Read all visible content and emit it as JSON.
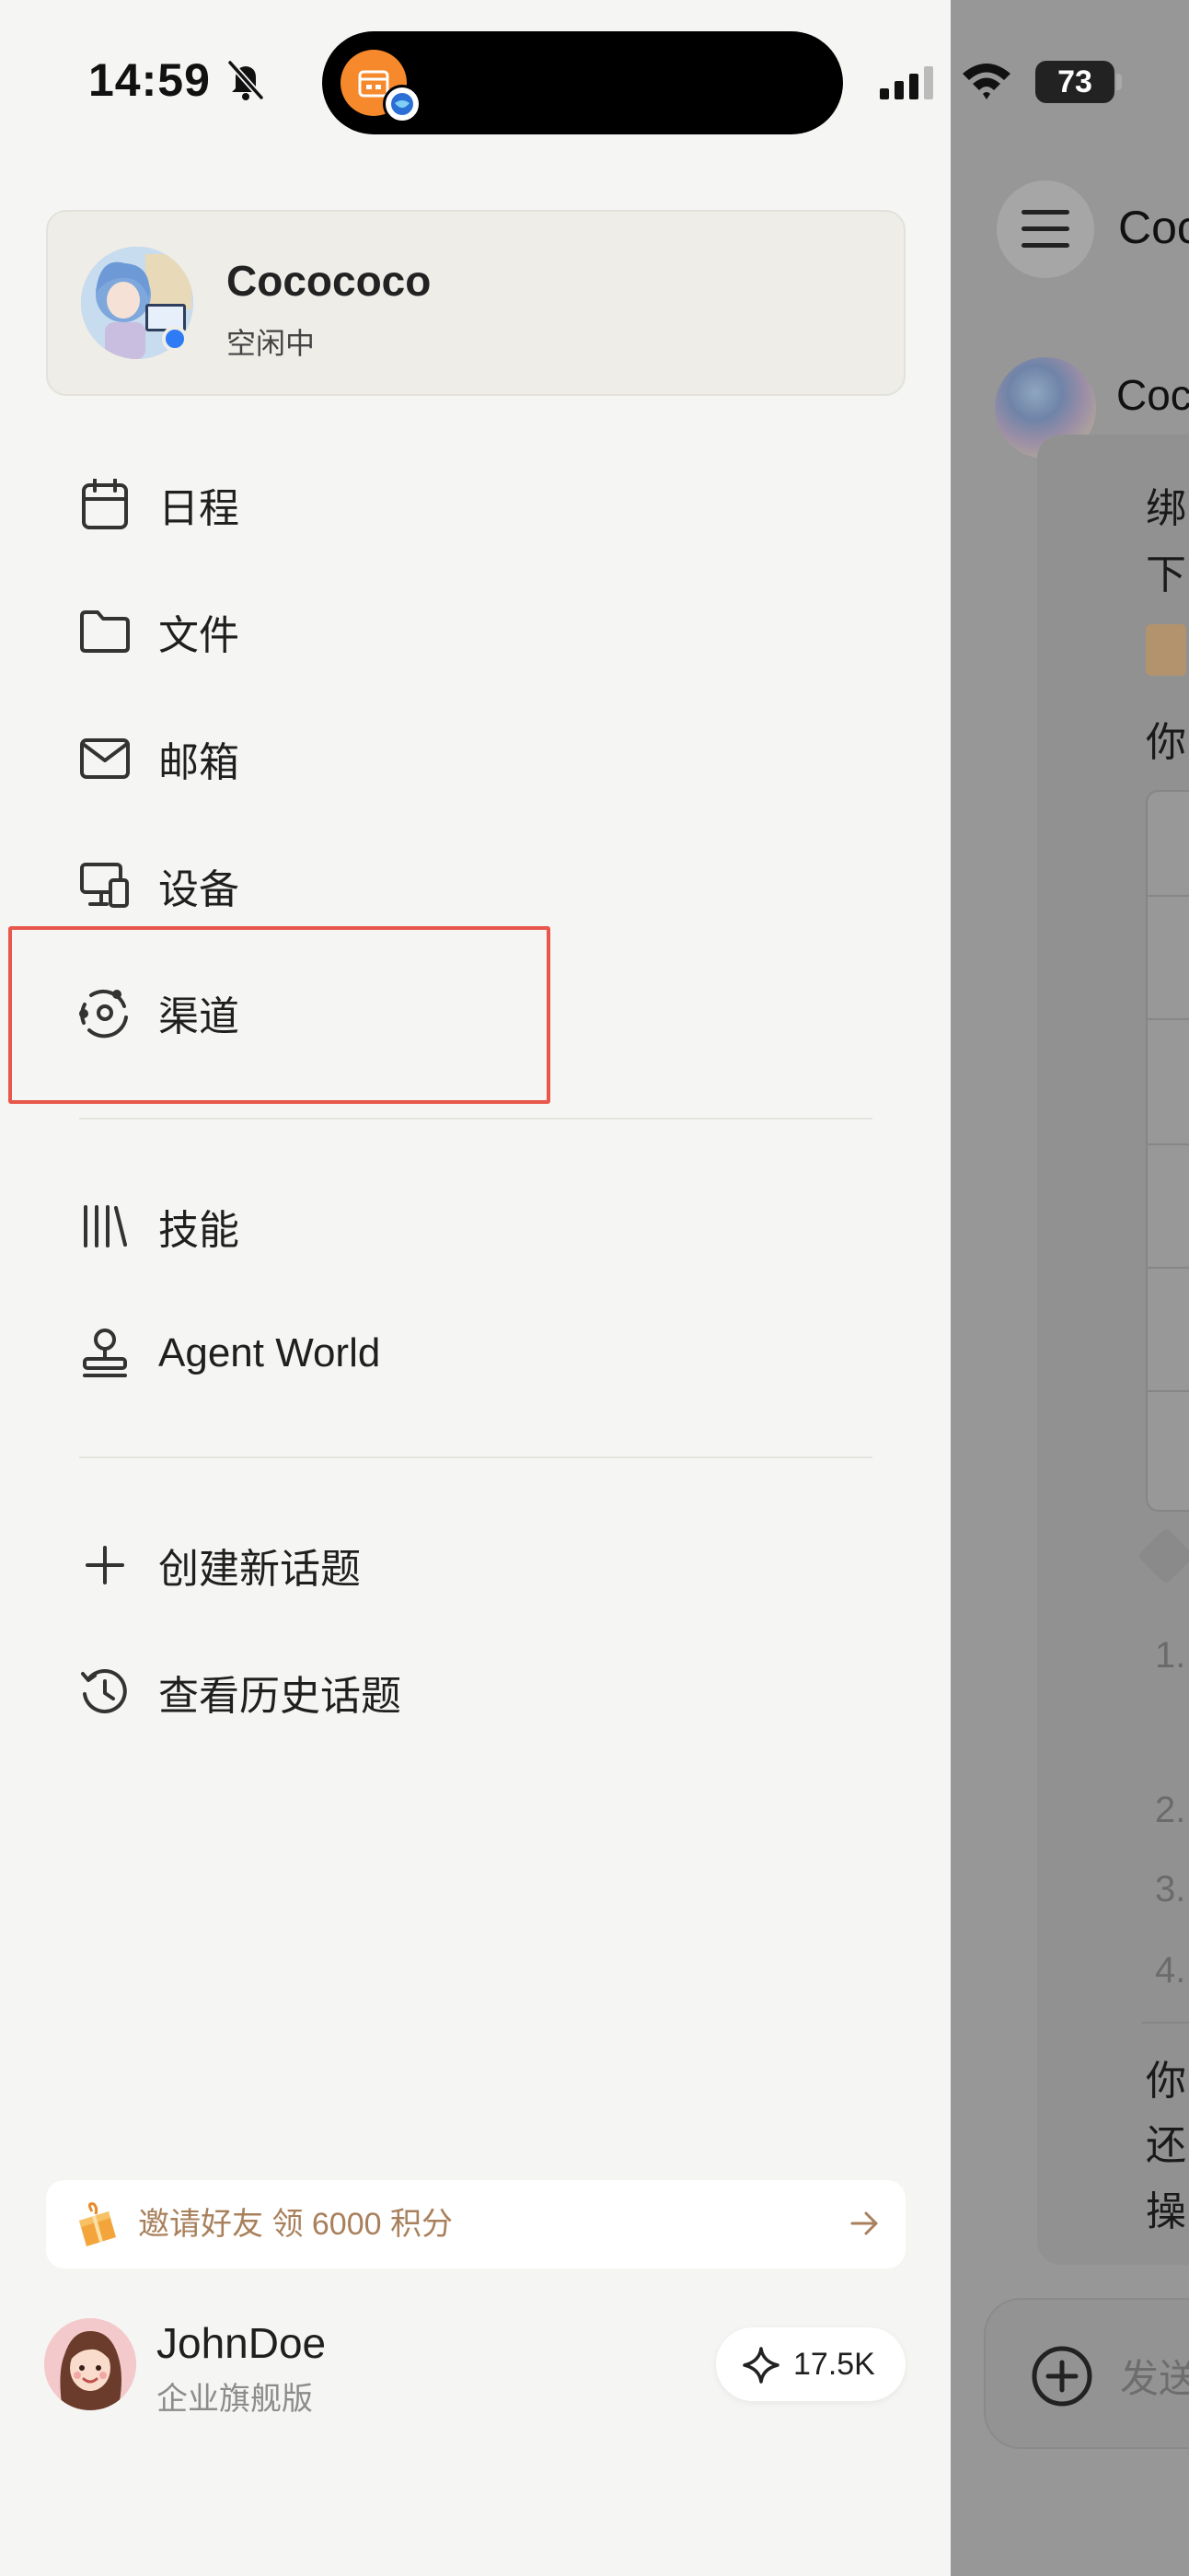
{
  "status_bar": {
    "time": "14:59",
    "battery": "73"
  },
  "profile": {
    "name": "Cocococo",
    "status": "空闲中",
    "status_color": "#2f7bf5"
  },
  "menu": {
    "items": [
      {
        "label": "日程",
        "icon": "calendar-icon"
      },
      {
        "label": "文件",
        "icon": "folder-icon"
      },
      {
        "label": "邮箱",
        "icon": "mail-icon"
      },
      {
        "label": "设备",
        "icon": "devices-icon"
      },
      {
        "label": "渠道",
        "icon": "channel-icon"
      }
    ],
    "group2": [
      {
        "label": "技能",
        "icon": "library-icon"
      },
      {
        "label": "Agent World",
        "icon": "stamp-icon"
      }
    ],
    "group3": [
      {
        "label": "创建新话题",
        "icon": "plus-icon"
      },
      {
        "label": "查看历史话题",
        "icon": "history-icon"
      }
    ]
  },
  "invite": {
    "text": "邀请好友 领 6000 积分",
    "color": "#a9805c"
  },
  "user": {
    "name": "JohnDoe",
    "plan": "企业旗舰版",
    "credits": "17.5K"
  },
  "chat": {
    "title": "Coc",
    "agent_name": "Coc",
    "bubble_chars": [
      "绑",
      "下",
      "你",
      "你",
      "还",
      "操"
    ],
    "list_numbers": [
      "1.",
      "2.",
      "3.",
      "4."
    ],
    "input_placeholder": "发送"
  },
  "highlight_color": "#e8574a"
}
